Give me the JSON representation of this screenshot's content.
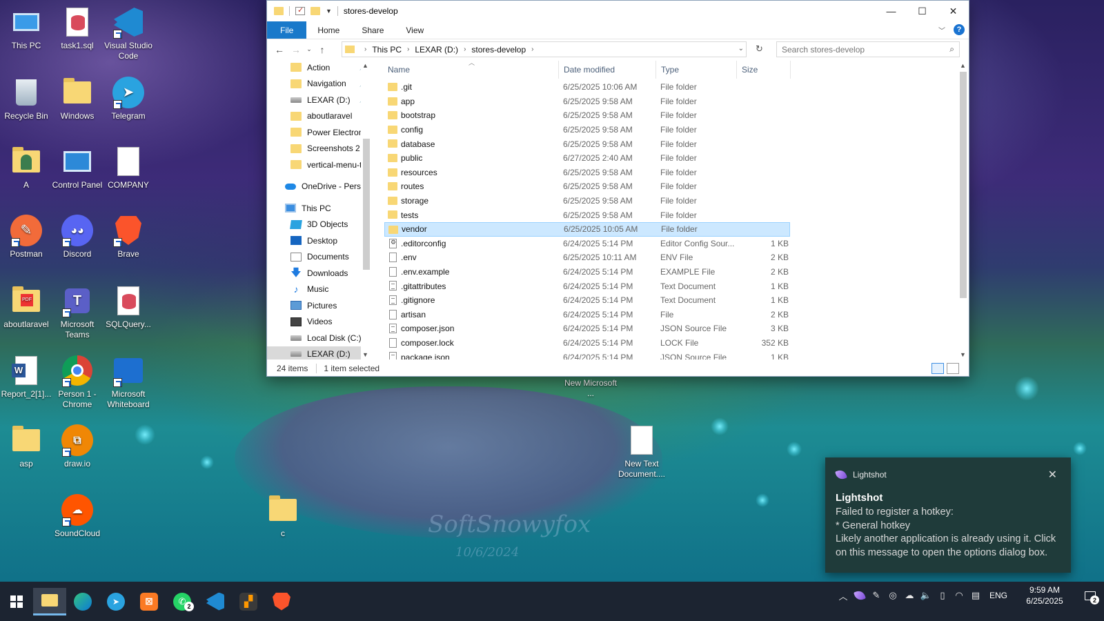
{
  "desktop": {
    "wallpaper_signature": "SoftSnowyfox",
    "wallpaper_date": "10/6/2024",
    "icons": [
      {
        "label": "This PC",
        "icon": "this-pc-icon"
      },
      {
        "label": "task1.sql",
        "icon": "sql-file-icon"
      },
      {
        "label": "Visual Studio Code",
        "icon": "vscode-icon"
      },
      {
        "label": "Recycle Bin",
        "icon": "recycle-bin-icon"
      },
      {
        "label": "Windows",
        "icon": "folder-icon"
      },
      {
        "label": "Telegram",
        "icon": "telegram-icon"
      },
      {
        "label": "A",
        "icon": "user-folder-icon"
      },
      {
        "label": "Control Panel",
        "icon": "control-panel-icon"
      },
      {
        "label": "COMPANY",
        "icon": "blank-file-icon"
      },
      {
        "label": "Postman",
        "icon": "postman-icon"
      },
      {
        "label": "Discord",
        "icon": "discord-icon"
      },
      {
        "label": "Brave",
        "icon": "brave-icon"
      },
      {
        "label": "aboutlaravel",
        "icon": "pdf-folder-icon"
      },
      {
        "label": "Microsoft Teams",
        "icon": "teams-icon"
      },
      {
        "label": "SQLQuery...",
        "icon": "sql-file-icon"
      },
      {
        "label": "Report_2[1]...",
        "icon": "word-icon"
      },
      {
        "label": "Person 1 - Chrome",
        "icon": "chrome-icon"
      },
      {
        "label": "Microsoft Whiteboard",
        "icon": "whiteboard-icon"
      },
      {
        "label": "asp",
        "icon": "folder-icon"
      },
      {
        "label": "draw.io",
        "icon": "drawio-icon"
      },
      {
        "label": "SoundCloud",
        "icon": "soundcloud-icon"
      },
      {
        "label": "c",
        "icon": "folder-icon"
      },
      {
        "label": "New Microsoft ...",
        "icon": "word-icon"
      },
      {
        "label": "New Text Document....",
        "icon": "text-file-icon"
      }
    ]
  },
  "explorer": {
    "title": "stores-develop",
    "window_buttons": {
      "minimize": "—",
      "maximize": "☐",
      "close": "✕"
    },
    "ribbon_tabs": [
      "File",
      "Home",
      "Share",
      "View"
    ],
    "help_label": "?",
    "breadcrumb": [
      "This PC",
      "LEXAR (D:)",
      "stores-develop"
    ],
    "search_placeholder": "Search stores-develop",
    "nav_pane": [
      {
        "label": "Action",
        "icon": "folder",
        "pinned": true
      },
      {
        "label": "Navigation",
        "icon": "folder",
        "pinned": true
      },
      {
        "label": "LEXAR (D:)",
        "icon": "drive",
        "pinned": true
      },
      {
        "label": "aboutlaravel",
        "icon": "folder",
        "pinned": false
      },
      {
        "label": "Power Electronic",
        "icon": "folder",
        "pinned": false
      },
      {
        "label": "Screenshots 2",
        "icon": "folder",
        "pinned": false
      },
      {
        "label": "vertical-menu-te",
        "icon": "folder",
        "pinned": false
      },
      {
        "label": "",
        "icon": "",
        "pinned": false
      },
      {
        "label": "OneDrive - Persor",
        "icon": "cloud",
        "pinned": false
      },
      {
        "label": "",
        "icon": "",
        "pinned": false
      },
      {
        "label": "This PC",
        "icon": "pc",
        "pinned": false
      },
      {
        "label": "3D Objects",
        "icon": "cube",
        "pinned": false
      },
      {
        "label": "Desktop",
        "icon": "desktop",
        "pinned": false
      },
      {
        "label": "Documents",
        "icon": "docs",
        "pinned": false
      },
      {
        "label": "Downloads",
        "icon": "down",
        "pinned": false
      },
      {
        "label": "Music",
        "icon": "music",
        "pinned": false
      },
      {
        "label": "Pictures",
        "icon": "pics",
        "pinned": false
      },
      {
        "label": "Videos",
        "icon": "videos",
        "pinned": false
      },
      {
        "label": "Local Disk (C:)",
        "icon": "drive",
        "pinned": false
      },
      {
        "label": "LEXAR (D:)",
        "icon": "drive",
        "pinned": false,
        "selected": true
      }
    ],
    "columns": [
      "Name",
      "Date modified",
      "Type",
      "Size"
    ],
    "files": [
      {
        "name": ".git",
        "date": "6/25/2025 10:06 AM",
        "type": "File folder",
        "size": "",
        "kind": "folder"
      },
      {
        "name": "app",
        "date": "6/25/2025 9:58 AM",
        "type": "File folder",
        "size": "",
        "kind": "folder"
      },
      {
        "name": "bootstrap",
        "date": "6/25/2025 9:58 AM",
        "type": "File folder",
        "size": "",
        "kind": "folder"
      },
      {
        "name": "config",
        "date": "6/25/2025 9:58 AM",
        "type": "File folder",
        "size": "",
        "kind": "folder"
      },
      {
        "name": "database",
        "date": "6/25/2025 9:58 AM",
        "type": "File folder",
        "size": "",
        "kind": "folder"
      },
      {
        "name": "public",
        "date": "6/27/2025 2:40 AM",
        "type": "File folder",
        "size": "",
        "kind": "folder"
      },
      {
        "name": "resources",
        "date": "6/25/2025 9:58 AM",
        "type": "File folder",
        "size": "",
        "kind": "folder"
      },
      {
        "name": "routes",
        "date": "6/25/2025 9:58 AM",
        "type": "File folder",
        "size": "",
        "kind": "folder"
      },
      {
        "name": "storage",
        "date": "6/25/2025 9:58 AM",
        "type": "File folder",
        "size": "",
        "kind": "folder"
      },
      {
        "name": "tests",
        "date": "6/25/2025 9:58 AM",
        "type": "File folder",
        "size": "",
        "kind": "folder"
      },
      {
        "name": "vendor",
        "date": "6/25/2025 10:05 AM",
        "type": "File folder",
        "size": "",
        "kind": "folder",
        "selected": true
      },
      {
        "name": ".editorconfig",
        "date": "6/24/2025 5:14 PM",
        "type": "Editor Config Sour...",
        "size": "1 KB",
        "kind": "gear"
      },
      {
        "name": ".env",
        "date": "6/25/2025 10:11 AM",
        "type": "ENV File",
        "size": "2 KB",
        "kind": "file"
      },
      {
        "name": ".env.example",
        "date": "6/24/2025 5:14 PM",
        "type": "EXAMPLE File",
        "size": "2 KB",
        "kind": "file"
      },
      {
        "name": ".gitattributes",
        "date": "6/24/2025 5:14 PM",
        "type": "Text Document",
        "size": "1 KB",
        "kind": "lines"
      },
      {
        "name": ".gitignore",
        "date": "6/24/2025 5:14 PM",
        "type": "Text Document",
        "size": "1 KB",
        "kind": "lines"
      },
      {
        "name": "artisan",
        "date": "6/24/2025 5:14 PM",
        "type": "File",
        "size": "2 KB",
        "kind": "file"
      },
      {
        "name": "composer.json",
        "date": "6/24/2025 5:14 PM",
        "type": "JSON Source File",
        "size": "3 KB",
        "kind": "lines"
      },
      {
        "name": "composer.lock",
        "date": "6/24/2025 5:14 PM",
        "type": "LOCK File",
        "size": "352 KB",
        "kind": "file"
      },
      {
        "name": "package.json",
        "date": "6/24/2025 5:14 PM",
        "type": "JSON Source File",
        "size": "1 KB",
        "kind": "lines"
      }
    ],
    "status": {
      "items": "24 items",
      "selected": "1 item selected"
    }
  },
  "toast": {
    "app_name": "Lightshot",
    "title": "Lightshot",
    "lines": [
      "Failed to register a hotkey:",
      "* General hotkey",
      "Likely another application is already using it. Click on this message to open the options dialog box."
    ]
  },
  "taskbar": {
    "apps": [
      "start-icon",
      "file-explorer-icon",
      "edge-icon",
      "telegram-icon",
      "xampp-icon",
      "whatsapp-icon",
      "vscode-icon",
      "sublime-icon",
      "brave-icon"
    ],
    "whatsapp_badge": "2",
    "language": "ENG",
    "time": "9:59 AM",
    "date": "6/25/2025",
    "notification_count": "2"
  }
}
